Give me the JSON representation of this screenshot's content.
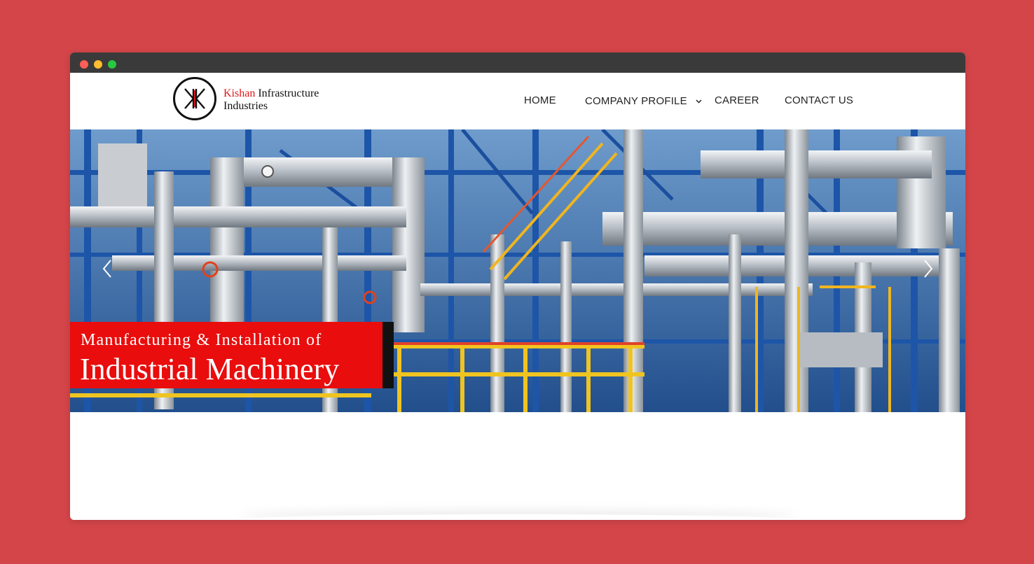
{
  "logo": {
    "name_accent": "Kishan",
    "name_rest": "Infrastructure",
    "name_line2": "Industries"
  },
  "nav": {
    "items": [
      {
        "label": "HOME"
      },
      {
        "label": "COMPANY PROFILE",
        "has_dropdown": true
      },
      {
        "label": "CAREER"
      },
      {
        "label": "CONTACT US"
      }
    ]
  },
  "hero": {
    "caption_line1": "Manufacturing & Installation of",
    "caption_line2": "Industrial Machinery",
    "prev_icon": "chevron-left-icon",
    "next_icon": "chevron-right-icon"
  },
  "colors": {
    "page_background": "#d44549",
    "titlebar": "#3a3a3a",
    "brand_red": "#e90d0d",
    "logo_accent": "#e2161c"
  }
}
